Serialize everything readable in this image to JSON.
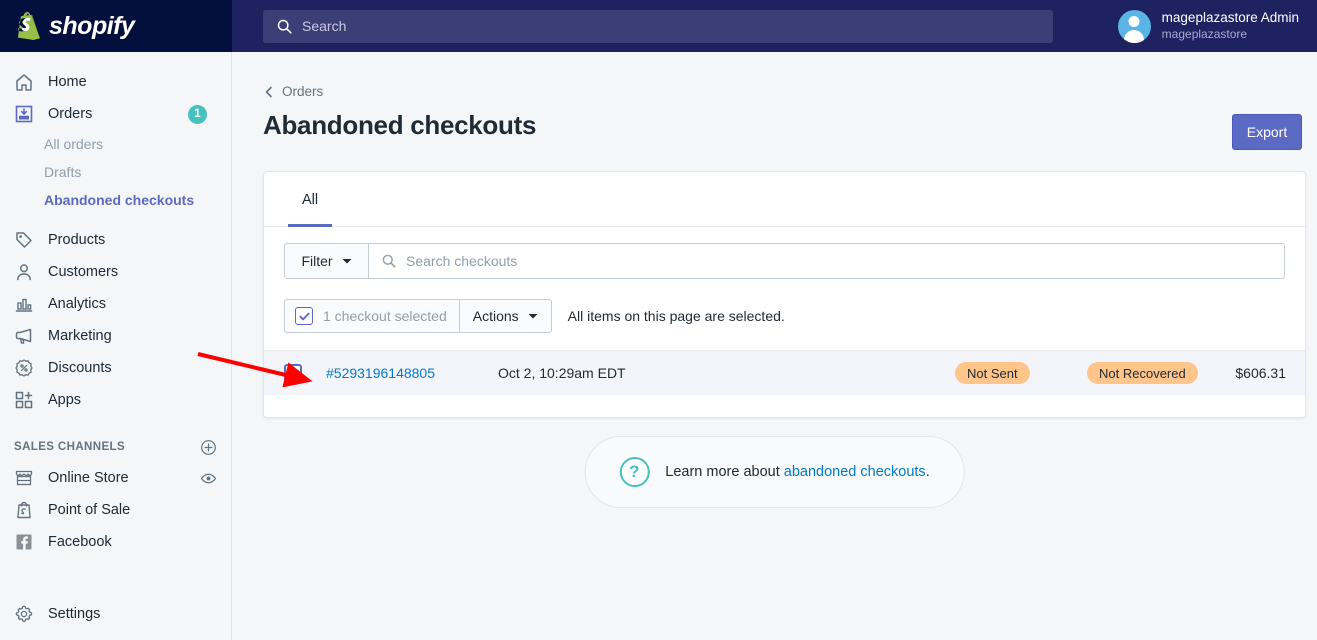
{
  "topbar": {
    "brand_name": "shopify",
    "brand_icon": "shopify-bag-icon",
    "search_placeholder": "Search",
    "search_icon": "search-icon",
    "account_name": "mageplazastore Admin",
    "account_store": "mageplazastore",
    "avatar_icon": "user-avatar-icon"
  },
  "sidebar": {
    "items": [
      {
        "label": "Home",
        "icon": "home-icon",
        "active": false
      },
      {
        "label": "Orders",
        "icon": "orders-inbox-icon",
        "active": true,
        "badge": "1"
      },
      {
        "label": "Products",
        "icon": "tag-icon",
        "active": false
      },
      {
        "label": "Customers",
        "icon": "person-icon",
        "active": false
      },
      {
        "label": "Analytics",
        "icon": "bar-chart-icon",
        "active": false
      },
      {
        "label": "Marketing",
        "icon": "megaphone-icon",
        "active": false
      },
      {
        "label": "Discounts",
        "icon": "percent-badge-icon",
        "active": false
      },
      {
        "label": "Apps",
        "icon": "apps-grid-plus-icon",
        "active": false
      }
    ],
    "sub_items": [
      {
        "label": "All orders",
        "current": false
      },
      {
        "label": "Drafts",
        "current": false
      },
      {
        "label": "Abandoned checkouts",
        "current": true
      }
    ],
    "sales_channels_title": "SALES CHANNELS",
    "sales_channels_add_icon": "plus-circle-icon",
    "channels": [
      {
        "label": "Online Store",
        "icon": "storefront-icon",
        "trailing_icon": "eye-icon"
      },
      {
        "label": "Point of Sale",
        "icon": "shopify-bag-icon"
      },
      {
        "label": "Facebook",
        "icon": "facebook-icon"
      }
    ],
    "settings": {
      "label": "Settings",
      "icon": "gear-icon"
    }
  },
  "main": {
    "breadcrumb": "Orders",
    "breadcrumb_icon": "chevron-left-icon",
    "page_title": "Abandoned checkouts",
    "export_label": "Export",
    "tabs": [
      {
        "label": "All",
        "selected": true
      }
    ],
    "filter_label": "Filter",
    "filter_caret_icon": "chevron-down-icon",
    "search_placeholder": "Search checkouts",
    "search_icon": "search-icon",
    "selection": {
      "checkbox_icon": "checkbox-checked-icon",
      "count_label": "1 checkout selected",
      "actions_label": "Actions",
      "actions_caret_icon": "chevron-down-icon",
      "note": "All items on this page are selected."
    },
    "rows": [
      {
        "checkbox_icon": "checkbox-checked-icon",
        "order": "#5293196148805",
        "date": "Oct 2, 10:29am EDT",
        "sent_status": "Not Sent",
        "recovery_status": "Not Recovered",
        "amount": "$606.31"
      }
    ],
    "help": {
      "icon": "question-circle-icon",
      "prefix": "Learn more about ",
      "link": "abandoned checkouts",
      "suffix": "."
    },
    "annotation_icon": "red-arrow-annotation"
  },
  "colors": {
    "brand_dark": "#030f3d",
    "topbar": "#1f2260",
    "accent_purple": "#5c6ac4",
    "badge_teal": "#47c1bf",
    "pill_orange": "#ffc58b",
    "link_blue": "#007ace",
    "annotation_red": "#ff0000"
  }
}
